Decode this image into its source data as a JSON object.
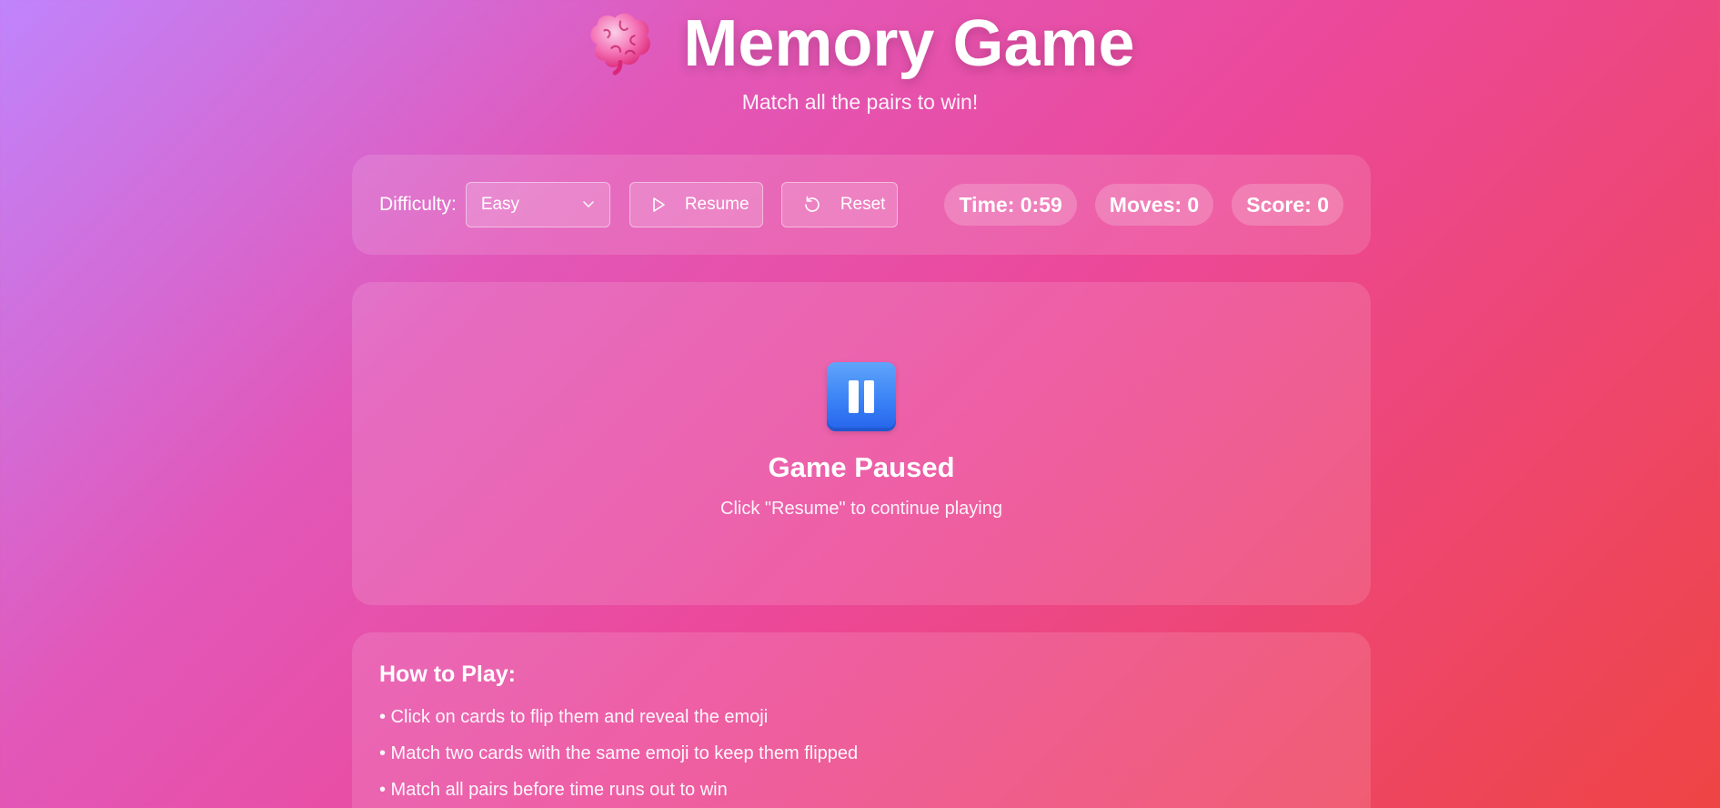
{
  "header": {
    "title": "Memory Game",
    "subtitle": "Match all the pairs to win!",
    "icon": "brain-icon"
  },
  "controls": {
    "difficulty_label": "Difficulty:",
    "difficulty_selected": "Easy",
    "resume_label": "Resume",
    "reset_label": "Reset"
  },
  "stats": {
    "time": "Time: 0:59",
    "moves": "Moves: 0",
    "score": "Score: 0"
  },
  "paused": {
    "title": "Game Paused",
    "message": "Click \"Resume\" to continue playing",
    "icon": "pause-icon"
  },
  "howto": {
    "title": "How to Play:",
    "items": [
      "• Click on cards to flip them and reveal the emoji",
      "• Match two cards with the same emoji to keep them flipped",
      "• Match all pairs before time runs out to win"
    ]
  },
  "colors": {
    "gradient_start": "#c084fc",
    "gradient_mid": "#ec4899",
    "gradient_end": "#ef4444",
    "pause_icon": "#3b82f6"
  }
}
